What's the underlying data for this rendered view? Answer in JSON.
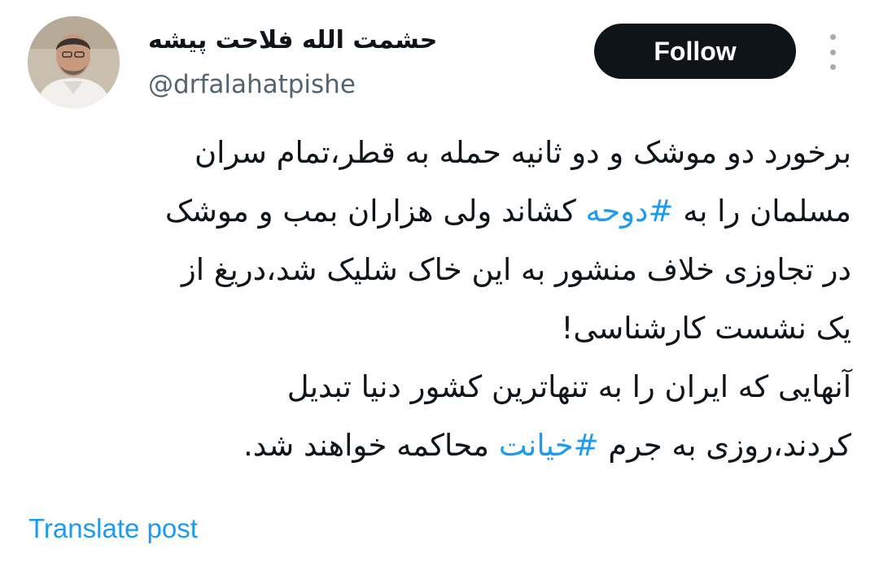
{
  "author": {
    "display_name": "حشمت الله فلاحت پیشه",
    "handle": "@drfalahatpishe",
    "avatar_icon": "profile-photo"
  },
  "header": {
    "follow_label": "Follow",
    "more_icon": "more-vertical-icon"
  },
  "tweet": {
    "lines": [
      {
        "parts": [
          {
            "text": "برخورد دو موشک و دو ثانیه حمله به قطر،تمام سران",
            "hashtag": false
          }
        ]
      },
      {
        "parts": [
          {
            "text": "مسلمان را به ",
            "hashtag": false
          },
          {
            "text": "#دوحه",
            "hashtag": true
          },
          {
            "text": " کشاند ولی هزاران بمب و موشک",
            "hashtag": false
          }
        ]
      },
      {
        "parts": [
          {
            "text": "در تجاوزی خلاف منشور به این خاک شلیک شد،دریغ از",
            "hashtag": false
          }
        ]
      },
      {
        "parts": [
          {
            "text": "یک نشست کارشناسی!",
            "hashtag": false
          }
        ]
      },
      {
        "parts": [
          {
            "text": " آنهایی که ایران را به تنهاترین کشور دنیا تبدیل",
            "hashtag": false
          }
        ]
      },
      {
        "parts": [
          {
            "text": "کردند،روزی به جرم ",
            "hashtag": false
          },
          {
            "text": "#خیانت",
            "hashtag": true
          },
          {
            "text": " محاکمه خواهند شد.",
            "hashtag": false
          }
        ]
      }
    ]
  },
  "footer": {
    "translate_label": "Translate post"
  },
  "colors": {
    "link": "#1d9bf0",
    "text": "#0f1419",
    "secondary": "#536471",
    "button_bg": "#0f1419"
  }
}
